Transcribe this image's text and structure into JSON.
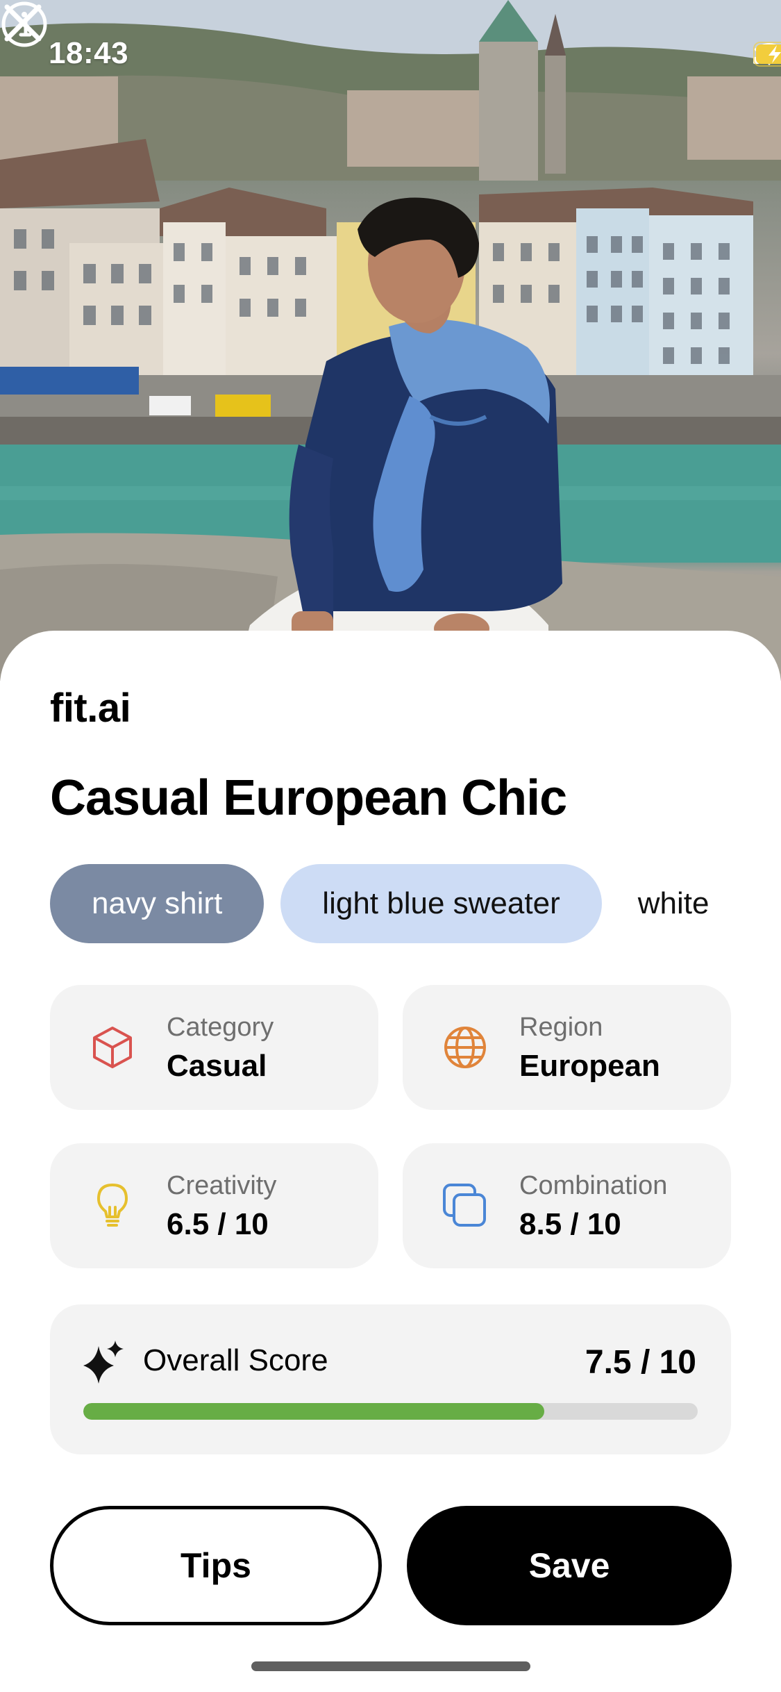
{
  "status_bar": {
    "time": "18:43",
    "signal_icon": "cellular-signal-icon",
    "wifi_icon": "wifi-icon",
    "battery_icon": "battery-charging-icon",
    "battery_color": "#f2cd3c"
  },
  "header": {
    "close_icon": "close-icon",
    "info_icon": "info-icon"
  },
  "photo": {
    "description_icon": "outfit-photo"
  },
  "brand": "fit.ai",
  "outfit": {
    "title": "Casual European Chic",
    "items": [
      "navy shirt",
      "light blue sweater",
      "white"
    ]
  },
  "metrics": [
    {
      "label": "Category",
      "value": "Casual",
      "icon": "cube-icon",
      "color": "#d9534f"
    },
    {
      "label": "Region",
      "value": "European",
      "icon": "globe-icon",
      "color": "#e0843a"
    },
    {
      "label": "Creativity",
      "value": "6.5 / 10",
      "icon": "lightbulb-icon",
      "color": "#e6c02e"
    },
    {
      "label": "Combination",
      "value": "8.5 / 10",
      "icon": "squares-stack-icon",
      "color": "#4a86d6"
    }
  ],
  "overall": {
    "label": "Overall Score",
    "value": "7.5 / 10",
    "progress": 0.75,
    "icon": "sparkles-icon",
    "bar_color": "#67ad45"
  },
  "actions": {
    "tips": "Tips",
    "save": "Save"
  }
}
